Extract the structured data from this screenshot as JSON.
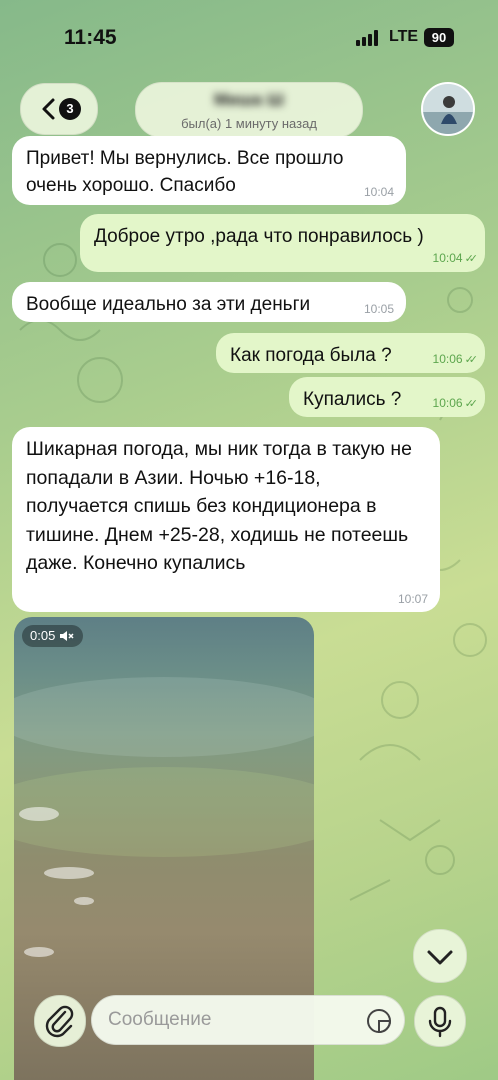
{
  "status_bar": {
    "time": "11:45",
    "network": "LTE",
    "battery": "90"
  },
  "header": {
    "back_badge": "3",
    "contact_name": "Миша Ш",
    "contact_status": "был(а) 1 минуту назад"
  },
  "messages": [
    {
      "direction": "in",
      "text": "Привет! Мы вернулись. Все прошло очень хорошо. Спасибо",
      "time": "10:04"
    },
    {
      "direction": "out",
      "text": "Доброе утро ,рада что понравилось )",
      "time": "10:04",
      "read": true
    },
    {
      "direction": "in",
      "text": "Вообще идеально за эти деньги",
      "time": "10:05"
    },
    {
      "direction": "out",
      "text": "Как погода была ?",
      "time": "10:06",
      "read": true
    },
    {
      "direction": "out",
      "text": "Купались ?",
      "time": "10:06",
      "read": true
    },
    {
      "direction": "in",
      "text": "Шикарная погода, мы ник тогда в такую не попадали в Азии. Ночью +16-18, получается спишь без кондиционера в тишине. Днем +25-28, ходишь не потеешь даже. Конечно купались",
      "time": "10:07"
    }
  ],
  "video": {
    "duration": "0:05",
    "muted": true
  },
  "composer": {
    "placeholder": "Сообщение"
  },
  "icons": {
    "back": "chevron-left-icon",
    "attach": "paperclip-icon",
    "sticker": "sticker-icon",
    "mic": "microphone-icon",
    "scroll": "chevron-down-icon",
    "muted": "speaker-muted-icon"
  },
  "colors": {
    "incoming_bubble": "#ffffff",
    "outgoing_bubble": "#e3f6c9",
    "check": "#5da64e"
  }
}
